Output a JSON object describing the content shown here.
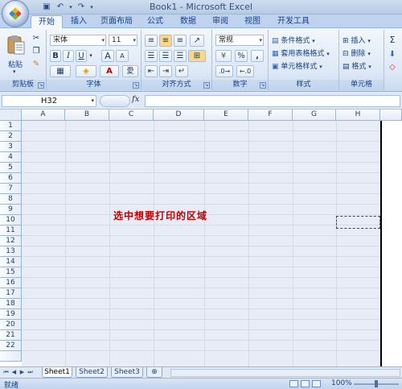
{
  "window": {
    "title": "Book1 - Microsoft Excel"
  },
  "quick_access": {
    "icons": [
      "excel-icon",
      "save-icon",
      "undo-icon",
      "redo-icon"
    ]
  },
  "tabs": [
    "开始",
    "插入",
    "页面布局",
    "公式",
    "数据",
    "审阅",
    "视图",
    "开发工具"
  ],
  "ribbon": {
    "clipboard": {
      "paste_label": "粘贴",
      "group_label": "剪贴板"
    },
    "font": {
      "font_name": "宋体",
      "font_size": "11",
      "bold": "B",
      "italic": "I",
      "underline": "U",
      "grow": "A",
      "shrink": "A",
      "group_label": "字体"
    },
    "alignment": {
      "group_label": "对齐方式"
    },
    "number": {
      "format": "常规",
      "percent": "%",
      "comma": ",",
      "group_label": "数字"
    },
    "styles": {
      "conditional": "条件格式",
      "table_format": "套用表格格式",
      "cell_styles": "单元格样式",
      "group_label": "样式"
    },
    "cells": {
      "insert": "插入",
      "delete": "删除",
      "format": "格式",
      "group_label": "单元格"
    },
    "editing": {
      "sigma": "Σ"
    }
  },
  "formula_bar": {
    "name_box": "H32",
    "fx": "fx",
    "formula": ""
  },
  "grid": {
    "columns": [
      "A",
      "B",
      "C",
      "D",
      "E",
      "F",
      "G",
      "H"
    ],
    "rows": [
      "1",
      "2",
      "3",
      "4",
      "5",
      "6",
      "7",
      "8",
      "9",
      "10",
      "11",
      "12",
      "13",
      "14",
      "15",
      "16",
      "17",
      "18",
      "19",
      "20",
      "21",
      "22"
    ]
  },
  "annotation": "选中想要打印的区域",
  "sheets": [
    "Sheet1",
    "Sheet2",
    "Sheet3"
  ],
  "status": {
    "ready": "就绪",
    "zoom": "100%"
  },
  "colors": {
    "accent": "#15428b",
    "annotation": "#c00000",
    "ribbon_bg": "#dde8f6"
  }
}
